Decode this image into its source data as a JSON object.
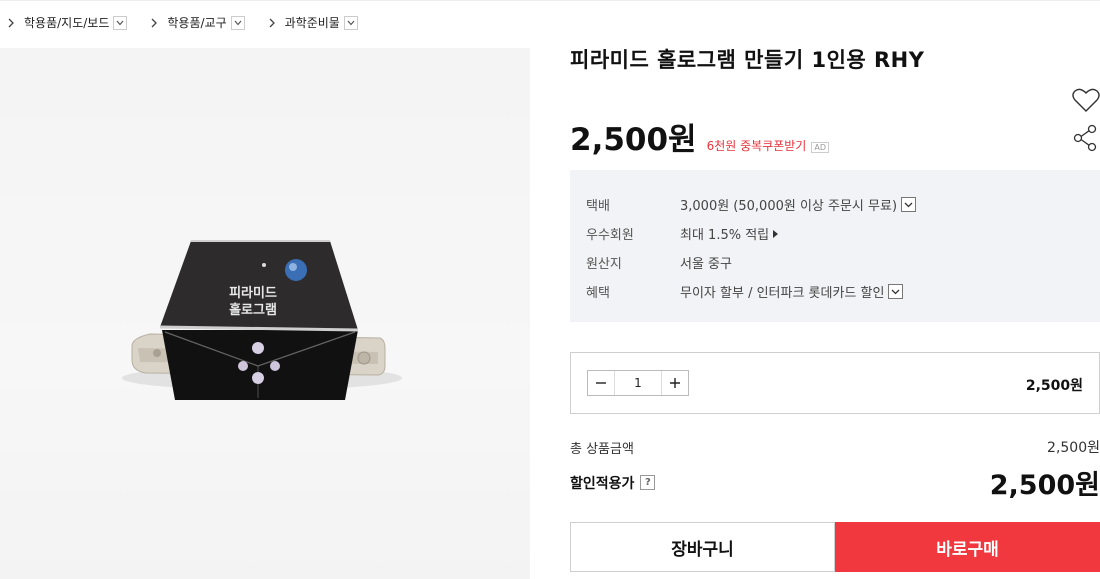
{
  "breadcrumb": {
    "items": [
      {
        "label": "학용품/지도/보드"
      },
      {
        "label": "학용품/교구"
      },
      {
        "label": "과학준비물"
      }
    ]
  },
  "product": {
    "title": "피라미드 홀로그램 만들기 1인용 RHY",
    "image_box_text_1": "피라미드",
    "image_box_text_2": "홀로그램",
    "price": "2,500원",
    "coupon_text": "6천원 중복쿠폰받기",
    "ad_badge": "AD"
  },
  "info": {
    "rows": [
      {
        "label": "택배",
        "value": "3,000원 (50,000원 이상 주문시 무료)"
      },
      {
        "label": "우수회원",
        "value": "최대 1.5% 적립"
      },
      {
        "label": "원산지",
        "value": "서울 중구"
      },
      {
        "label": "혜택",
        "value": "무이자 할부 / 인터파크 롯데카드 할인"
      }
    ]
  },
  "quantity": {
    "value": "1",
    "line_price": "2,500원"
  },
  "summary": {
    "total_label": "총 상품금액",
    "total_value": "2,500원",
    "discount_label": "할인적용가",
    "help_icon": "?",
    "discount_value": "2,500원"
  },
  "actions": {
    "cart_label": "장바구니",
    "buy_label": "바로구매"
  },
  "colors": {
    "accent": "#f0383e",
    "coupon": "#e8333c",
    "info_bg": "#f2f3f7"
  }
}
